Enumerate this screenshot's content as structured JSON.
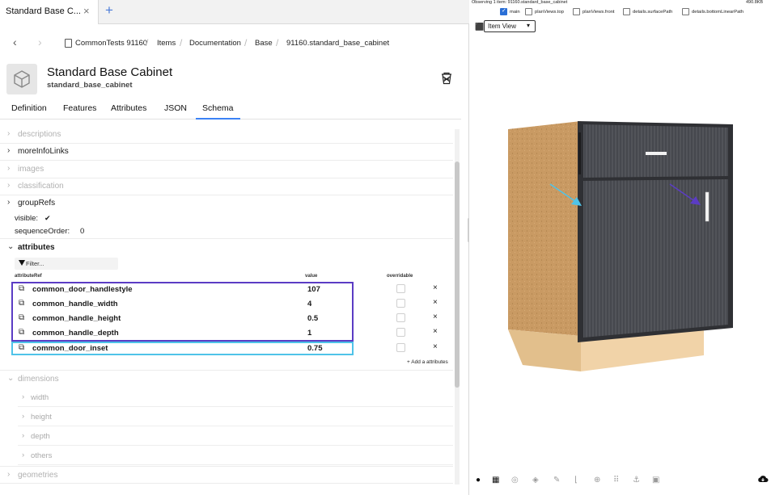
{
  "tab": {
    "title": "Standard Base C...",
    "close": "×",
    "add": "+"
  },
  "breadcrumb": {
    "back": "‹",
    "forward": "›",
    "items": [
      "CommonTests 91160",
      "Items",
      "Documentation",
      "Base",
      "91160.standard_base_cabinet"
    ],
    "sep": "/"
  },
  "header": {
    "title": "Standard Base Cabinet",
    "subtitle": "standard_base_cabinet"
  },
  "tabs": [
    "Definition",
    "Features",
    "Attributes",
    "JSON",
    "Schema"
  ],
  "active_tab": "Schema",
  "sections": {
    "descriptions": "descriptions",
    "moreInfoLinks": "moreInfoLinks",
    "images": "images",
    "classification": "classification",
    "groupRefs": "groupRefs",
    "visible_label": "visible:",
    "visible_value": "✔",
    "sequenceOrder_label": "sequenceOrder:",
    "sequenceOrder_value": "0",
    "attributes": "attributes",
    "dimensions": "dimensions",
    "dim_children": [
      "width",
      "height",
      "depth",
      "others"
    ],
    "geometries": "geometries",
    "chev_right": "›",
    "chev_down": "⌄"
  },
  "attributes": {
    "filter_placeholder": "Filter...",
    "col_ref": "attributeRef",
    "col_value": "value",
    "col_overridable": "overridable",
    "rows": [
      {
        "name": "common_door_handlestyle",
        "value": "107"
      },
      {
        "name": "common_handle_width",
        "value": "4"
      },
      {
        "name": "common_handle_height",
        "value": "0.5"
      },
      {
        "name": "common_handle_depth",
        "value": "1"
      },
      {
        "name": "common_door_inset",
        "value": "0.75"
      }
    ],
    "remove": "×",
    "add_label": "+ Add a attributes"
  },
  "viewer": {
    "observing": "Observing 1 item: 91160.standard_base_cabinet",
    "size": "490.8KB",
    "views": [
      {
        "label": "main",
        "checked": true
      },
      {
        "label": "planViews.top",
        "checked": false
      },
      {
        "label": "planViews.front",
        "checked": false
      },
      {
        "label": "details.surfacePath",
        "checked": false
      },
      {
        "label": "details.bottomLinearPath",
        "checked": false
      }
    ],
    "mode": "Item View",
    "mode_chevron": "▾",
    "colors": {
      "door": "#4b4d52",
      "side": "#c99a63",
      "toe": "#f1d3a8",
      "arrow_cyan": "#4fc3e8",
      "arrow_purple": "#5b3cc4"
    }
  },
  "toolbar": [
    "palette",
    "grid",
    "disc",
    "cube",
    "brush",
    "corner",
    "target",
    "dots",
    "anchor",
    "frame"
  ],
  "toolbar_glyphs": [
    "●",
    "▦",
    "◎",
    "◈",
    "✎",
    "⌊",
    "⊕",
    "⠿",
    "⚓",
    "▣"
  ],
  "cloud_label": "cloud-download"
}
